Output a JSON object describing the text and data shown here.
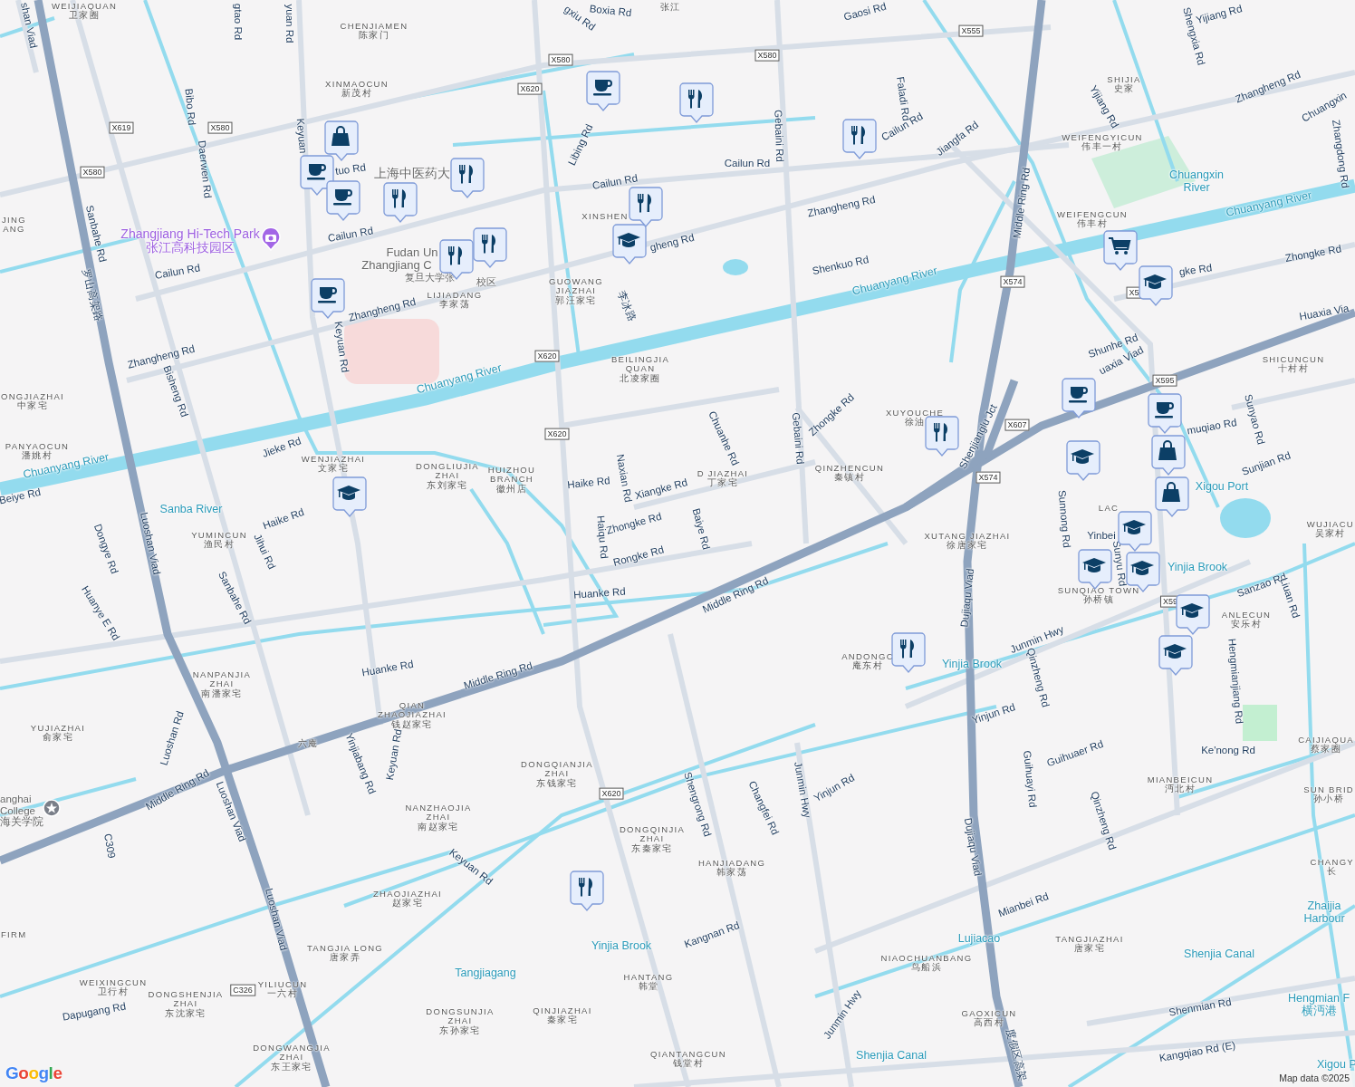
{
  "map": {
    "roads": [
      {
        "text": "shan Viad"
      },
      {
        "text": "gtao Rd"
      },
      {
        "text": "yuan Rd"
      },
      {
        "text": "Bibo Rd"
      },
      {
        "text": "Daerwen Rd"
      },
      {
        "text": "Keyuan"
      },
      {
        "text": "tuo Rd"
      },
      {
        "text": "Sanbahe Rd"
      },
      {
        "text": "罗山高架路"
      },
      {
        "text": "Cailun Rd"
      },
      {
        "text": "Cailun Rd"
      },
      {
        "text": "Zhangheng Rd"
      },
      {
        "text": "Keyuan Rd"
      },
      {
        "text": "Zhangheng Rd"
      },
      {
        "text": "Bisheng Rd"
      },
      {
        "text": "Boxia Rd"
      },
      {
        "text": "gxiu Rd"
      },
      {
        "text": "Gaosi Rd"
      },
      {
        "text": "Libing Rd"
      },
      {
        "text": "Cailun Rd"
      },
      {
        "text": "Cailun Rd"
      },
      {
        "text": "Gebaini Rd"
      },
      {
        "text": "Faladi Rd"
      },
      {
        "text": "Cailun Rd"
      },
      {
        "text": "Jiangfa Rd"
      },
      {
        "text": "gheng Rd"
      },
      {
        "text": "Zhangheng Rd"
      },
      {
        "text": "Shenkuo Rd"
      },
      {
        "text": "李冰路"
      },
      {
        "text": "Shengxia Rd"
      },
      {
        "text": "Yijiang Rd"
      },
      {
        "text": "Yijiang Rd"
      },
      {
        "text": "Zhangheng Rd"
      },
      {
        "text": "Chuangxin"
      },
      {
        "text": "Zhangdong Rd"
      },
      {
        "text": "Middle Ring Rd"
      },
      {
        "text": "gke Rd"
      },
      {
        "text": "Zhongke Rd"
      },
      {
        "text": "Shunhe Rd"
      },
      {
        "text": "uaxia Viad"
      },
      {
        "text": "Huaxia Via"
      },
      {
        "text": "Zhongke Rd"
      },
      {
        "text": "Chuanhe Rd"
      },
      {
        "text": "Gebaini Rd"
      },
      {
        "text": "Jieke Rd"
      },
      {
        "text": "Haike Rd"
      },
      {
        "text": "Jihui Rd"
      },
      {
        "text": "Beiye Rd"
      },
      {
        "text": "Dongye Rd"
      },
      {
        "text": "Huanye E Rd"
      },
      {
        "text": "Luoshan Viad"
      },
      {
        "text": "Sanbahe Rd"
      },
      {
        "text": "Haike Rd"
      },
      {
        "text": "Naxian Rd"
      },
      {
        "text": "Xiangke Rd"
      },
      {
        "text": "Zhongke Rd"
      },
      {
        "text": "Baiye Rd"
      },
      {
        "text": "Haiqu Rd"
      },
      {
        "text": "Rongke Rd"
      },
      {
        "text": "Huanke Rd"
      },
      {
        "text": "Middle Ring Rd"
      },
      {
        "text": "Huanke Rd"
      },
      {
        "text": "Middle Ring Rd"
      },
      {
        "text": "Shenjianglu Jct"
      },
      {
        "text": "muqiao Rd"
      },
      {
        "text": "Sunyao Rd"
      },
      {
        "text": "Sunjian Rd"
      },
      {
        "text": "Sunnong Rd"
      },
      {
        "text": "Yinbei"
      },
      {
        "text": "Sunyu Rd"
      },
      {
        "text": "Dujiaqu Viad"
      },
      {
        "text": "Junmin Hwy"
      },
      {
        "text": "Sanzao Rd"
      },
      {
        "text": "Liuan Rd"
      },
      {
        "text": "Qinzheng Rd"
      },
      {
        "text": "Hengmianjiang Rd"
      },
      {
        "text": "Yinjun Rd"
      },
      {
        "text": "Ke'nong Rd"
      },
      {
        "text": "Guihuaer Rd"
      },
      {
        "text": "Guihuayi Rd"
      },
      {
        "text": "Qinzheng Rd"
      },
      {
        "text": "Junmin Hwy"
      },
      {
        "text": "Yinjun Rd"
      },
      {
        "text": "Changfei Rd"
      },
      {
        "text": "Shengrong Rd"
      },
      {
        "text": "Dujiaqu Viad"
      },
      {
        "text": "Mianbei Rd"
      },
      {
        "text": "Kangnan Rd"
      },
      {
        "text": "Junmin Hwy"
      },
      {
        "text": "Shenmian Rd"
      },
      {
        "text": "Kangqiao Rd (E)"
      },
      {
        "text": "度假区高架"
      },
      {
        "text": "Luoshan Rd"
      },
      {
        "text": "Middle Ring Rd"
      },
      {
        "text": "Luoshan Viad"
      },
      {
        "text": "Luoshan Viad"
      },
      {
        "text": "Yinjiabang Rd"
      },
      {
        "text": "Keyuan Rd"
      },
      {
        "text": "Keyuan Rd"
      },
      {
        "text": "C309"
      },
      {
        "text": "Dapugang Rd"
      }
    ],
    "shields": [
      "X580",
      "X580",
      "X555",
      "X620",
      "X619",
      "X580",
      "X580",
      "X620",
      "X620",
      "X574",
      "X5",
      "X595",
      "X607",
      "X574",
      "X59",
      "X620",
      "C326"
    ],
    "places": [
      {
        "lines": [
          "WEIJIAQUAN",
          "卫家圈"
        ]
      },
      {
        "lines": [
          "CHENJIAMEN",
          "陈家门"
        ]
      },
      {
        "lines": [
          "XINMAOCUN",
          "新茂村"
        ]
      },
      {
        "lines": [
          "JING",
          "ANG"
        ]
      },
      {
        "lines": [
          "LIJIADANG",
          "李家荡"
        ]
      },
      {
        "lines": [
          "GUOWANG",
          "JIAZHAI",
          "郭汪家宅"
        ]
      },
      {
        "lines": [
          "XINSHEN"
        ]
      },
      {
        "lines": [
          "BEILINGJIA",
          "QUAN",
          "北凌家圈"
        ]
      },
      {
        "lines": [
          "SHIJIA",
          "史家"
        ]
      },
      {
        "lines": [
          "WEIFENGYICUN",
          "伟丰一村"
        ]
      },
      {
        "lines": [
          "WEIFENGCUN",
          "伟丰村"
        ]
      },
      {
        "lines": [
          "SHICUNCUN",
          "十村村"
        ]
      },
      {
        "lines": [
          "ONGJIAZHAI",
          "中家宅"
        ]
      },
      {
        "lines": [
          "PANYAOCUN",
          "潘姚村"
        ]
      },
      {
        "lines": [
          "WENJIAZHAI",
          "文家宅"
        ]
      },
      {
        "lines": [
          "DONGLIUJIA",
          "ZHAI",
          "东刘家宅"
        ]
      },
      {
        "lines": [
          "HUIZHOU",
          "BRANCH",
          "徽州店"
        ]
      },
      {
        "lines": [
          "D JIAZHAI",
          "丁家宅"
        ]
      },
      {
        "lines": [
          "QINZHENCUN",
          "秦镇村"
        ]
      },
      {
        "lines": [
          "XUYOUCHE",
          "徐油"
        ]
      },
      {
        "lines": [
          "YUMINCUN",
          "渔民村"
        ]
      },
      {
        "lines": [
          "XUTANG JIAZHAI",
          "徐唐家宅"
        ]
      },
      {
        "lines": [
          "SUNQIAO TOWN",
          "孙桥镇"
        ]
      },
      {
        "lines": [
          "LAC"
        ]
      },
      {
        "lines": [
          "WUJIACU",
          "吴家村"
        ]
      },
      {
        "lines": [
          "ANLECUN",
          "安乐村"
        ]
      },
      {
        "lines": [
          "ANDONGC",
          "庵东村"
        ]
      },
      {
        "lines": [
          "NANPANJIA",
          "ZHAI",
          "南潘家宅"
        ]
      },
      {
        "lines": [
          "YUJIAZHAI",
          "俞家宅"
        ]
      },
      {
        "lines": [
          "QIAN",
          "ZHAOJIAZHAI",
          "钱赵家宅"
        ]
      },
      {
        "lines": [
          "六庵"
        ]
      },
      {
        "lines": [
          "CAIJIAQUA",
          "蔡家圈"
        ]
      },
      {
        "lines": [
          "MIANBEICUN",
          "沔北村"
        ]
      },
      {
        "lines": [
          "SUN BRID",
          "孙小桥"
        ]
      },
      {
        "lines": [
          "CHANGY",
          "长"
        ]
      },
      {
        "lines": [
          "DONGQIANJIA",
          "ZHAI",
          "东钱家宅"
        ]
      },
      {
        "lines": [
          "NANZHAOJIA",
          "ZHAI",
          "南赵家宅"
        ]
      },
      {
        "lines": [
          "DONGQINJIA",
          "ZHAI",
          "东秦家宅"
        ]
      },
      {
        "lines": [
          "HANJIADANG",
          "韩家荡"
        ]
      },
      {
        "lines": [
          "ZHAOJIAZHAI",
          "赵家宅"
        ]
      },
      {
        "lines": [
          "TANGJIA LONG",
          "唐家弄"
        ]
      },
      {
        "lines": [
          "WEIXINGCUN",
          "卫行村"
        ]
      },
      {
        "lines": [
          "DONGSHENJIA",
          "ZHAI",
          "东沈家宅"
        ]
      },
      {
        "lines": [
          "YILIUCUN",
          "一六村"
        ]
      },
      {
        "lines": [
          "DONGSUNJIA",
          "ZHAI",
          "东孙家宅"
        ]
      },
      {
        "lines": [
          "QINJIAZHAI",
          "秦家宅"
        ]
      },
      {
        "lines": [
          "HANTANG",
          "韩堂"
        ]
      },
      {
        "lines": [
          "DONGWANGJIA",
          "ZHAI",
          "东王家宅"
        ]
      },
      {
        "lines": [
          "QIANTANGCUN",
          "钱堂村"
        ]
      },
      {
        "lines": [
          "NIAOCHUANBANG",
          "鸟船浜"
        ]
      },
      {
        "lines": [
          "TANGJIAZHAI",
          "唐家宅"
        ]
      },
      {
        "lines": [
          "GAOXICUN",
          "高西村"
        ]
      },
      {
        "lines": [
          "FIRM"
        ]
      },
      {
        "lines": [
          "张江"
        ]
      }
    ],
    "landmarks": [
      {
        "lines": [
          "上海中医药大"
        ]
      },
      {
        "lines": [
          "Fudan Un"
        ]
      },
      {
        "lines": [
          "Zhangjiang C"
        ]
      },
      {
        "lines": [
          "复旦大学张"
        ]
      },
      {
        "lines": [
          "校区"
        ]
      },
      {
        "lines": [
          "anghai",
          "College",
          "海关学院"
        ]
      }
    ],
    "poi": {
      "lines": [
        "Zhangjiang Hi-Tech Park",
        "张江高科技园区"
      ]
    },
    "water_labels": [
      {
        "lines": [
          "Chuanyang River"
        ]
      },
      {
        "lines": [
          "Chuanyang River"
        ]
      },
      {
        "lines": [
          "Chuanyang River"
        ]
      },
      {
        "lines": [
          "Chuanyang River"
        ]
      },
      {
        "lines": [
          "Chuangxin",
          "River"
        ]
      },
      {
        "lines": [
          "Sanba River"
        ]
      },
      {
        "lines": [
          "Xigou Port"
        ]
      },
      {
        "lines": [
          "Yinjia Brook"
        ]
      },
      {
        "lines": [
          "Yinjia Brook"
        ]
      },
      {
        "lines": [
          "Yinjia Brook"
        ]
      },
      {
        "lines": [
          "Tangjiagang"
        ]
      },
      {
        "lines": [
          "Lujiacao"
        ]
      },
      {
        "lines": [
          "Shenjia Canal"
        ]
      },
      {
        "lines": [
          "Shenjia Canal"
        ]
      },
      {
        "lines": [
          "Zhaijia",
          "Harbour"
        ]
      },
      {
        "lines": [
          "Hengmian F",
          "横沔港"
        ]
      },
      {
        "lines": [
          "Xigou P"
        ]
      }
    ],
    "pins": [
      {
        "kind": "restaurant"
      },
      {
        "kind": "cafe"
      },
      {
        "kind": "restaurant"
      },
      {
        "kind": "shopping"
      },
      {
        "kind": "cafe"
      },
      {
        "kind": "cafe"
      },
      {
        "kind": "restaurant"
      },
      {
        "kind": "restaurant"
      },
      {
        "kind": "restaurant"
      },
      {
        "kind": "school"
      },
      {
        "kind": "restaurant"
      },
      {
        "kind": "restaurant"
      },
      {
        "kind": "cafe"
      },
      {
        "kind": "grocery"
      },
      {
        "kind": "school"
      },
      {
        "kind": "school"
      },
      {
        "kind": "cafe"
      },
      {
        "kind": "cafe"
      },
      {
        "kind": "shopping"
      },
      {
        "kind": "shopping"
      },
      {
        "kind": "school"
      },
      {
        "kind": "school"
      },
      {
        "kind": "school"
      },
      {
        "kind": "school"
      },
      {
        "kind": "school"
      },
      {
        "kind": "school"
      },
      {
        "kind": "restaurant"
      },
      {
        "kind": "restaurant"
      },
      {
        "kind": "restaurant"
      }
    ]
  },
  "logo": "Google",
  "attribution": "Map data ©2025"
}
